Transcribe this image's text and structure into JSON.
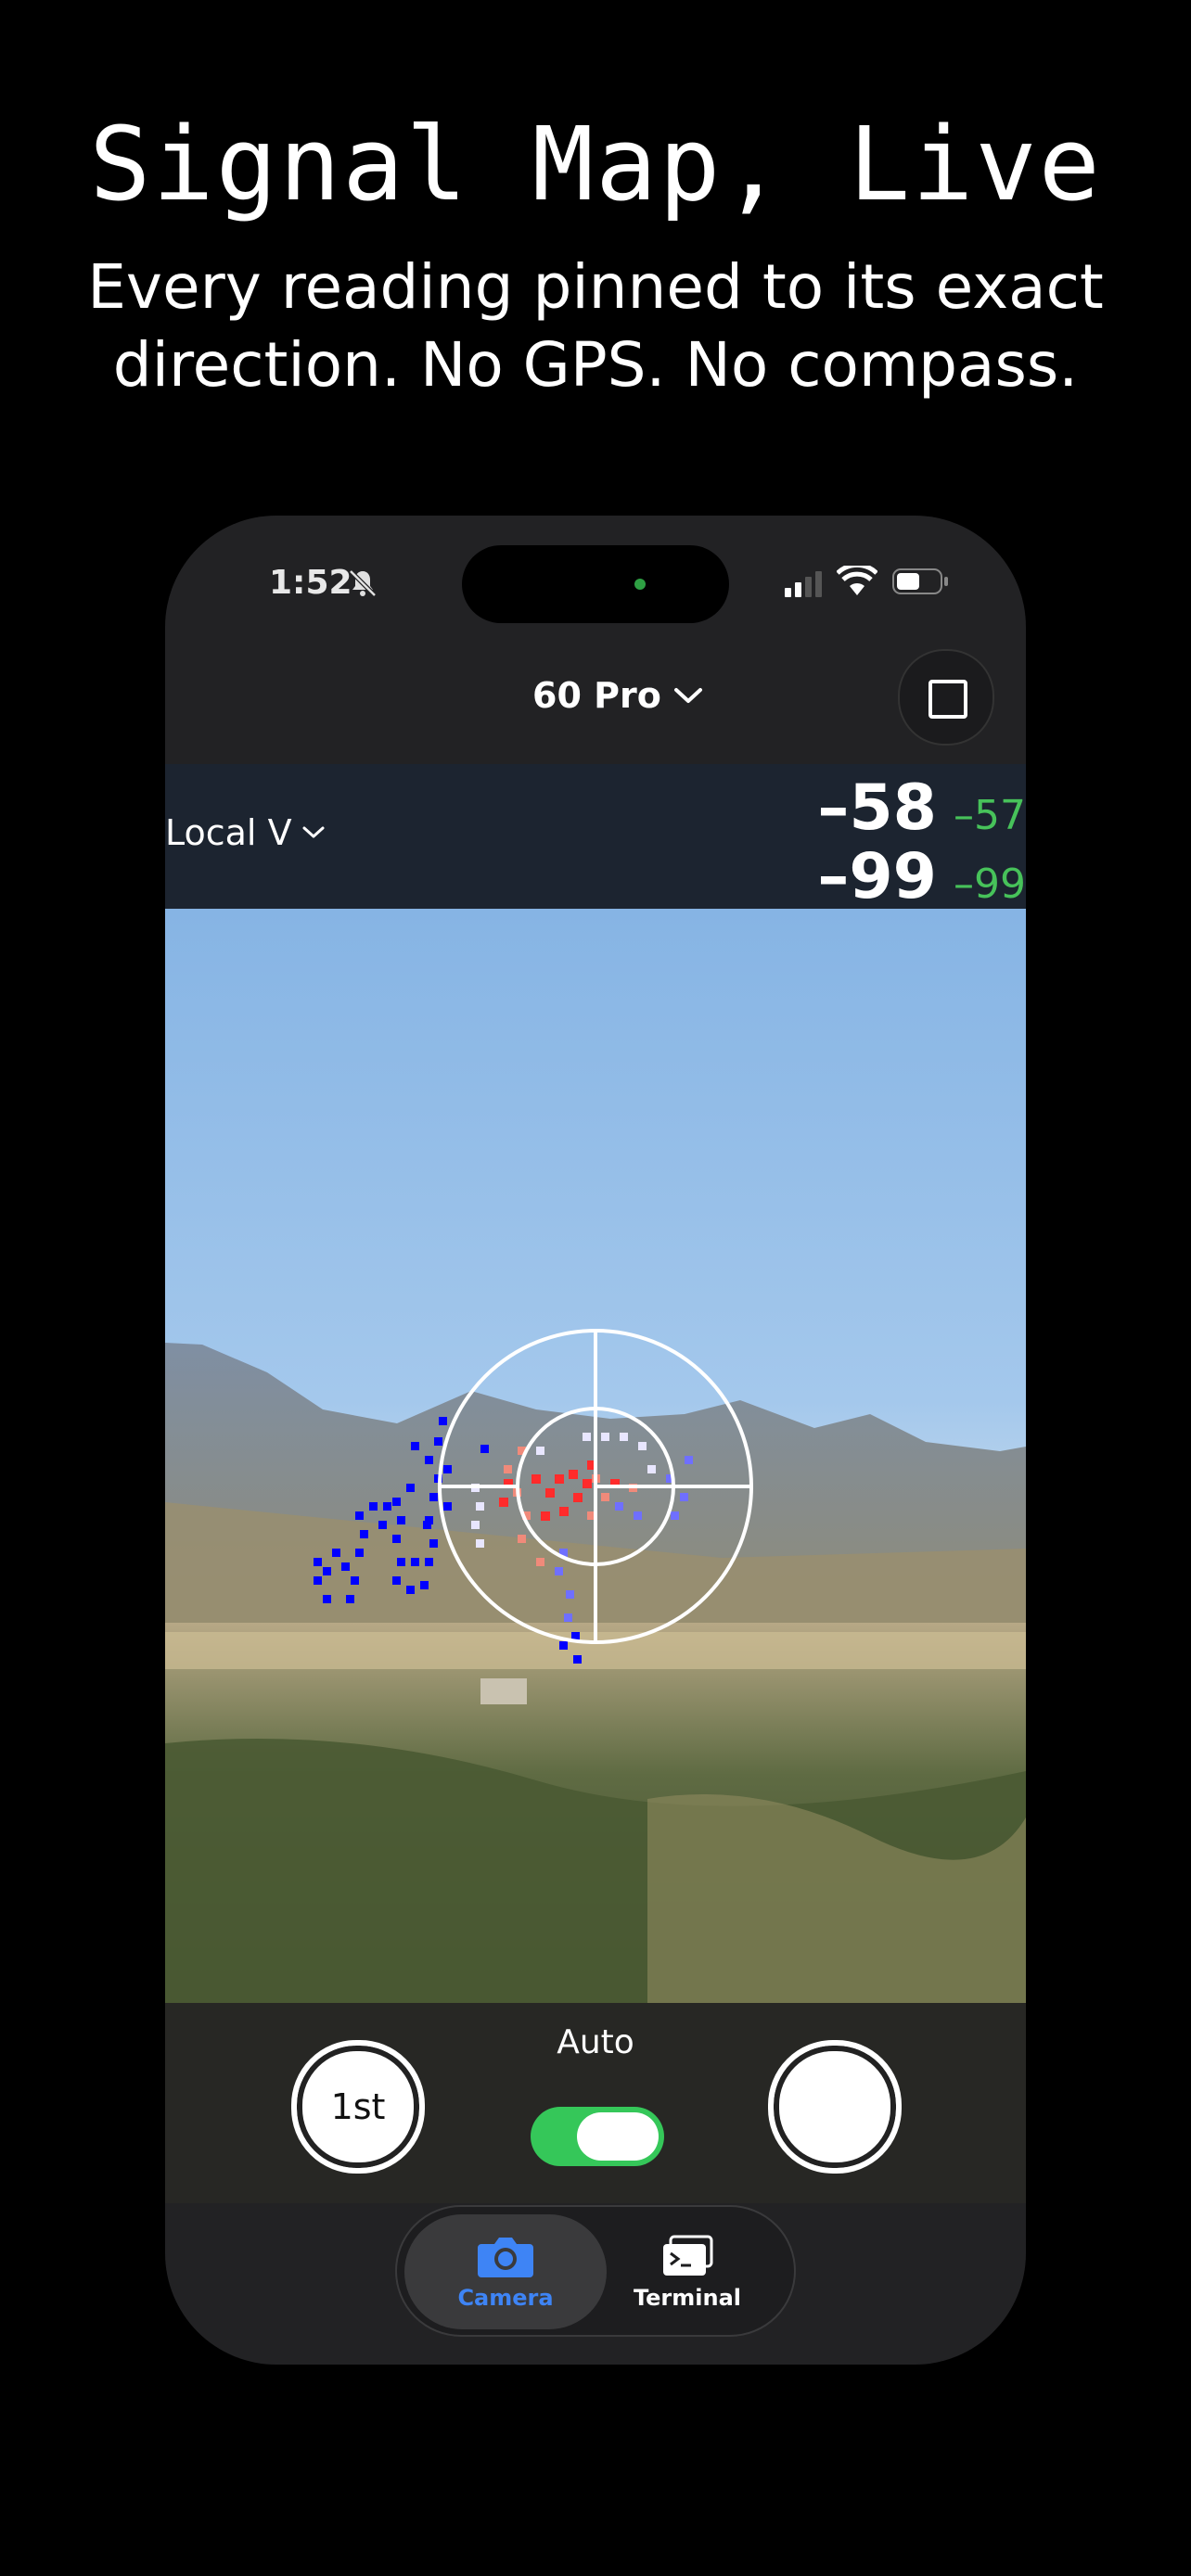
{
  "headline": {
    "title": "Signal Map, Live",
    "subtitle_line1": "Every reading pinned to its exact",
    "subtitle_line2": "direction. No GPS. No compass."
  },
  "status_bar": {
    "time": "1:52"
  },
  "nav": {
    "device": "60 Pro"
  },
  "readings": {
    "selector": "Local V",
    "row1": {
      "value": "–58",
      "secondary": "–57"
    },
    "row2": {
      "value": "–99",
      "secondary": "–99"
    }
  },
  "controls": {
    "first_button": "1st",
    "mode_label": "Auto",
    "toggle_on": true
  },
  "tabs": [
    {
      "label": "Camera",
      "active": true
    },
    {
      "label": "Terminal",
      "active": false
    }
  ],
  "colors": {
    "accent_blue": "#3e84f5",
    "toggle_green": "#35c759",
    "reading_green": "#47c25a",
    "signal_strong": "#ff2b2b",
    "signal_weak": "#0000ff"
  }
}
